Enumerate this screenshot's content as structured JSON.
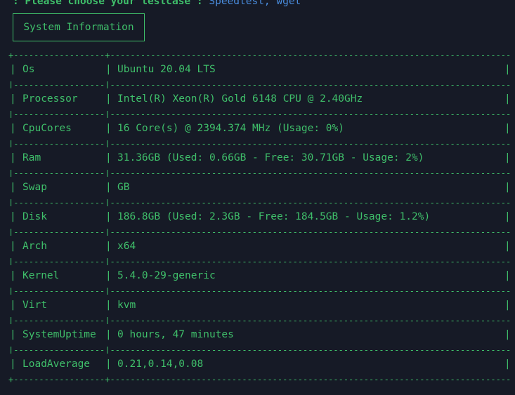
{
  "prompt": {
    "label": ": Please choose your testcase :",
    "choices": "Speedtest, wget"
  },
  "section": {
    "title": "System Information"
  },
  "table": {
    "rows": [
      {
        "key": "Os",
        "value": "Ubuntu 20.04 LTS"
      },
      {
        "key": "Processor",
        "value": "Intel(R) Xeon(R) Gold 6148 CPU @ 2.40GHz"
      },
      {
        "key": "CpuCores",
        "value": "16 Core(s) @ 2394.374 MHz (Usage: 0%)"
      },
      {
        "key": "Ram",
        "value": "31.36GB (Used: 0.66GB - Free: 30.71GB - Usage: 2%)"
      },
      {
        "key": "Swap",
        "value": "GB"
      },
      {
        "key": "Disk",
        "value": "186.8GB (Used: 2.3GB - Free: 184.5GB - Usage: 1.2%)"
      },
      {
        "key": "Arch",
        "value": "x64"
      },
      {
        "key": "Kernel",
        "value": "5.4.0-29-generic"
      },
      {
        "key": "Virt",
        "value": "kvm"
      },
      {
        "key": "SystemUptime",
        "value": "0 hours, 47 minutes"
      },
      {
        "key": "LoadAverage",
        "value": "0.21,0.14,0.08"
      }
    ]
  },
  "colors": {
    "background": "#161a26",
    "text_green": "#3fbf6a",
    "choice_blue": "#4a8ee0"
  }
}
